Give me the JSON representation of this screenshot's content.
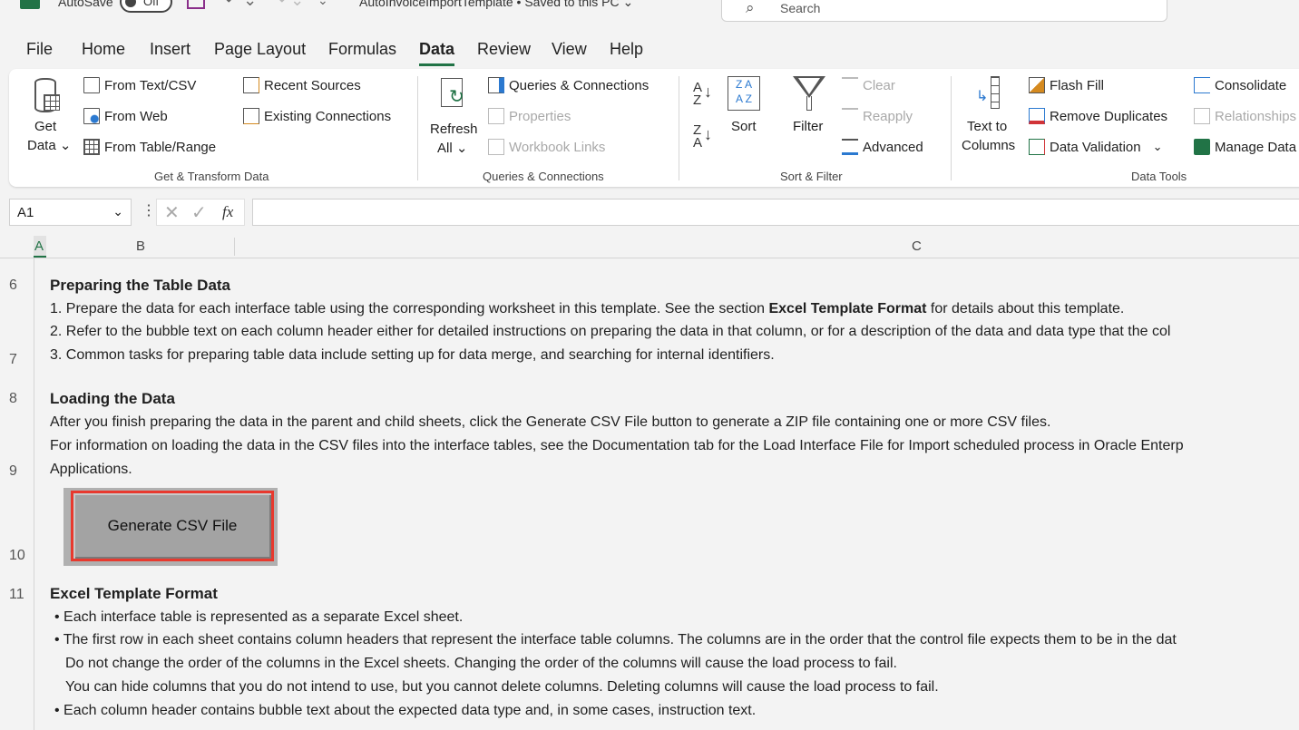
{
  "titlebar": {
    "autosave_label": "AutoSave",
    "autosave_state": "Off",
    "doc_title": "AutoInvoiceImportTemplate • Saved to this PC ⌄",
    "search_placeholder": "Search"
  },
  "menu": [
    "File",
    "Home",
    "Insert",
    "Page Layout",
    "Formulas",
    "Data",
    "Review",
    "View",
    "Help"
  ],
  "ribbon": {
    "get_data_line1": "Get",
    "get_data_line2": "Data ⌄",
    "from_text_csv": "From Text/CSV",
    "from_web": "From Web",
    "from_table_range": "From Table/Range",
    "recent_sources": "Recent Sources",
    "existing_connections": "Existing Connections",
    "group_get_transform": "Get & Transform Data",
    "refresh_line1": "Refresh",
    "refresh_line2": "All ⌄",
    "queries_connections": "Queries & Connections",
    "properties": "Properties",
    "workbook_links": "Workbook Links",
    "group_queries": "Queries & Connections",
    "sort": "Sort",
    "filter": "Filter",
    "clear": "Clear",
    "reapply": "Reapply",
    "advanced": "Advanced",
    "group_sort_filter": "Sort & Filter",
    "text_to_columns_line1": "Text to",
    "text_to_columns_line2": "Columns",
    "flash_fill": "Flash Fill",
    "remove_duplicates": "Remove Duplicates",
    "data_validation": "Data Validation",
    "consolidate": "Consolidate",
    "relationships": "Relationships",
    "manage_data": "Manage Data",
    "group_data_tools": "Data Tools"
  },
  "formula_bar": {
    "name_box": "A1",
    "fx": "fx",
    "formula": ""
  },
  "columns": [
    "A",
    "B",
    "C"
  ],
  "rows": {
    "r6": "6",
    "r7": "7",
    "r8": "8",
    "r9": "9",
    "r10": "10",
    "r11": "11"
  },
  "sheet": {
    "h_prepare": "Preparing the Table Data",
    "p1_a": "1. Prepare the data for each interface table using the corresponding worksheet in this template. See the section ",
    "p1_b": "Excel Template Format",
    "p1_c": " for details about this template.",
    "p2": "2. Refer to the bubble text on each column header either for detailed instructions on preparing the data in that column, or for a description of the data and data type that the col",
    "p3": "3. Common tasks for preparing table data include setting up for data merge, and searching for internal identifiers.",
    "h_loading": "Loading the Data",
    "l1": "After you finish preparing the data in the parent and child sheets, click the Generate CSV File button to generate a ZIP file containing one or more CSV files.",
    "l2": "For information on loading the data in the CSV files into the interface tables, see the Documentation tab for the Load Interface File for Import scheduled process in Oracle Enterp",
    "l3": "Applications.",
    "generate_button": "Generate CSV File",
    "h_format": "Excel Template Format",
    "f1": "• Each interface table is represented as a separate Excel sheet.",
    "f2": "• The first row in each sheet contains column headers that represent the interface table columns. The columns are in the order that the control file expects them to be in the dat",
    "f3": "Do not change the order of the columns in the Excel sheets. Changing the order of the columns will cause the load process to fail.",
    "f4": "You can hide columns that you do not intend to use, but you cannot delete columns. Deleting columns will cause the load process to fail.",
    "f5": "• Each column header contains bubble text about the expected data type and, in some cases, instruction text."
  },
  "colors": {
    "accent": "#217346",
    "highlight": "#e8392e",
    "button": "#a3a3a3"
  }
}
